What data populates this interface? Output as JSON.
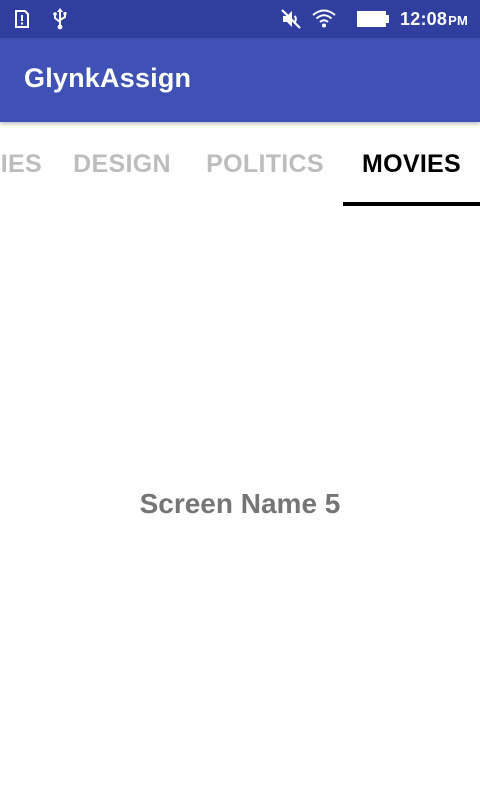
{
  "status_bar": {
    "time": "12:08",
    "ampm": "PM",
    "icons": [
      "sim-alert-icon",
      "usb-icon",
      "mute-icon",
      "wifi-icon",
      "battery-icon"
    ]
  },
  "app_bar": {
    "title": "GlynkAssign"
  },
  "tabs": [
    {
      "label": "IES",
      "selected": false
    },
    {
      "label": "DESIGN",
      "selected": false
    },
    {
      "label": "POLITICS",
      "selected": false
    },
    {
      "label": "MOVIES",
      "selected": true
    }
  ],
  "content": {
    "screen_name": "Screen Name 5"
  },
  "colors": {
    "status_bar": "#303f9f",
    "app_bar": "#3f51b5",
    "tab_inactive": "#bdbdbd",
    "tab_active": "#000000",
    "screen_text": "#757575"
  }
}
